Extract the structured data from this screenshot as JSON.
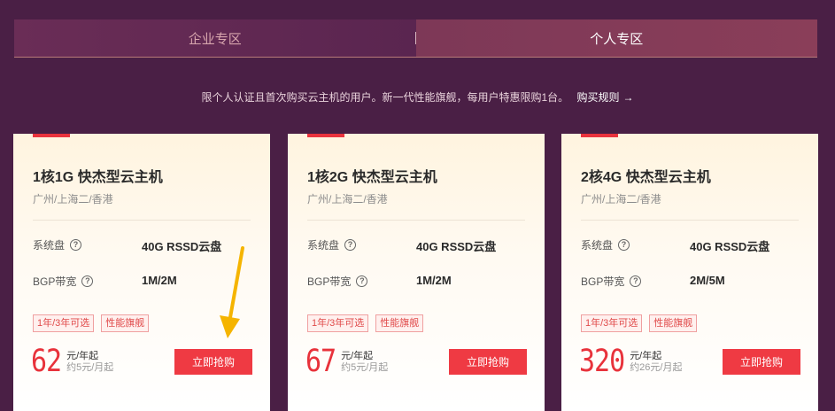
{
  "tabs": [
    {
      "label": "企业专区",
      "active": false
    },
    {
      "label": "个人专区",
      "active": true
    }
  ],
  "notice": {
    "text": "限个人认证且首次购买云主机的用户。新一代性能旗舰，每用户特惠限购1台。",
    "link": "购买规则",
    "arrow": "→"
  },
  "cards": [
    {
      "title": "1核1G 快杰型云主机",
      "region": "广州/上海二/香港",
      "specs": [
        {
          "label": "系统盘",
          "value": "40G RSSD云盘"
        },
        {
          "label": "BGP带宽",
          "value": "1M/2M"
        }
      ],
      "tags": [
        "1年/3年可选",
        "性能旗舰"
      ],
      "price": "62",
      "price_unit": "元/年起",
      "price_sub": "约5元/月起",
      "button": "立即抢购"
    },
    {
      "title": "1核2G 快杰型云主机",
      "region": "广州/上海二/香港",
      "specs": [
        {
          "label": "系统盘",
          "value": "40G RSSD云盘"
        },
        {
          "label": "BGP带宽",
          "value": "1M/2M"
        }
      ],
      "tags": [
        "1年/3年可选",
        "性能旗舰"
      ],
      "price": "67",
      "price_unit": "元/年起",
      "price_sub": "约5元/月起",
      "button": "立即抢购"
    },
    {
      "title": "2核4G 快杰型云主机",
      "region": "广州/上海二/香港",
      "specs": [
        {
          "label": "系统盘",
          "value": "40G RSSD云盘"
        },
        {
          "label": "BGP带宽",
          "value": "2M/5M"
        }
      ],
      "tags": [
        "1年/3年可选",
        "性能旗舰"
      ],
      "price": "320",
      "price_unit": "元/年起",
      "price_sub": "约26元/月起",
      "button": "立即抢购"
    }
  ],
  "help_glyph": "?",
  "colors": {
    "background": "#4a1f45",
    "accent_red": "#ef3a43",
    "annotation_yellow": "#f5b400"
  }
}
